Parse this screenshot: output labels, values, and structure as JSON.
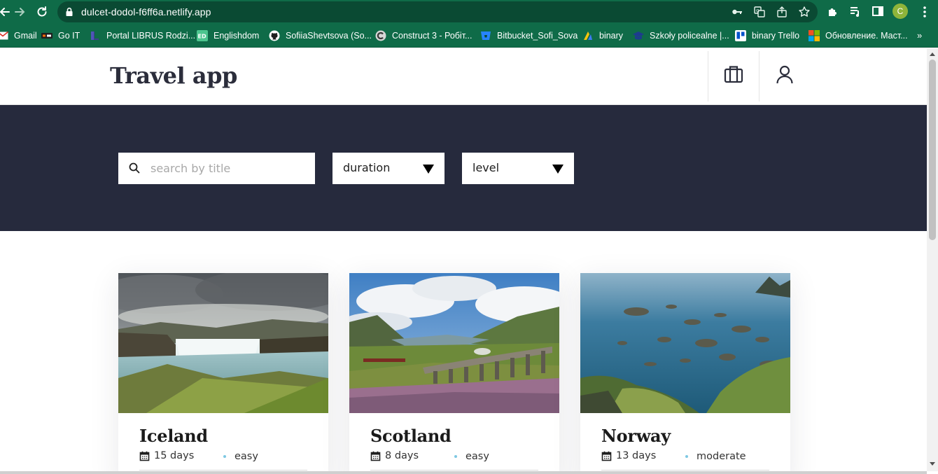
{
  "browser": {
    "url": "dulcet-dodol-f6ff6a.netlify.app",
    "profile_initial": "C",
    "accent_color": "#0f6b48",
    "bookmarks": [
      {
        "label": "Gmail",
        "icon": "gmail-icon"
      },
      {
        "label": "Go IT",
        "icon": "goit-icon"
      },
      {
        "label": "Portal LIBRUS Rodzi...",
        "icon": "librus-icon"
      },
      {
        "label": "Englishdom",
        "icon": "englishdom-icon"
      },
      {
        "label": "SofiiaShevtsova (So...",
        "icon": "github-icon"
      },
      {
        "label": "Construct 3 - Робіт...",
        "icon": "construct-icon"
      },
      {
        "label": "Bitbucket_Sofi_Sova",
        "icon": "bitbucket-icon"
      },
      {
        "label": "binary",
        "icon": "binary-icon"
      },
      {
        "label": "Szkoły policealne |...",
        "icon": "graduation-cap-icon"
      },
      {
        "label": "binary Trello",
        "icon": "trello-icon"
      },
      {
        "label": "Обновление. Маст...",
        "icon": "microsoft-icon"
      }
    ],
    "more_label": "»"
  },
  "site": {
    "logo": "Travel app",
    "header_bg": "#ffffff",
    "filter_bg": "#262a3d"
  },
  "filters": {
    "search_placeholder": "search by title",
    "search_value": "",
    "duration_label": "duration",
    "level_label": "level"
  },
  "trips": [
    {
      "title": "Iceland",
      "duration": "15 days",
      "level": "easy",
      "image": "waterfall-landscape"
    },
    {
      "title": "Scotland",
      "duration": "8 days",
      "level": "easy",
      "image": "viaduct-landscape"
    },
    {
      "title": "Norway",
      "duration": "13 days",
      "level": "moderate",
      "image": "archipelago-landscape"
    }
  ]
}
